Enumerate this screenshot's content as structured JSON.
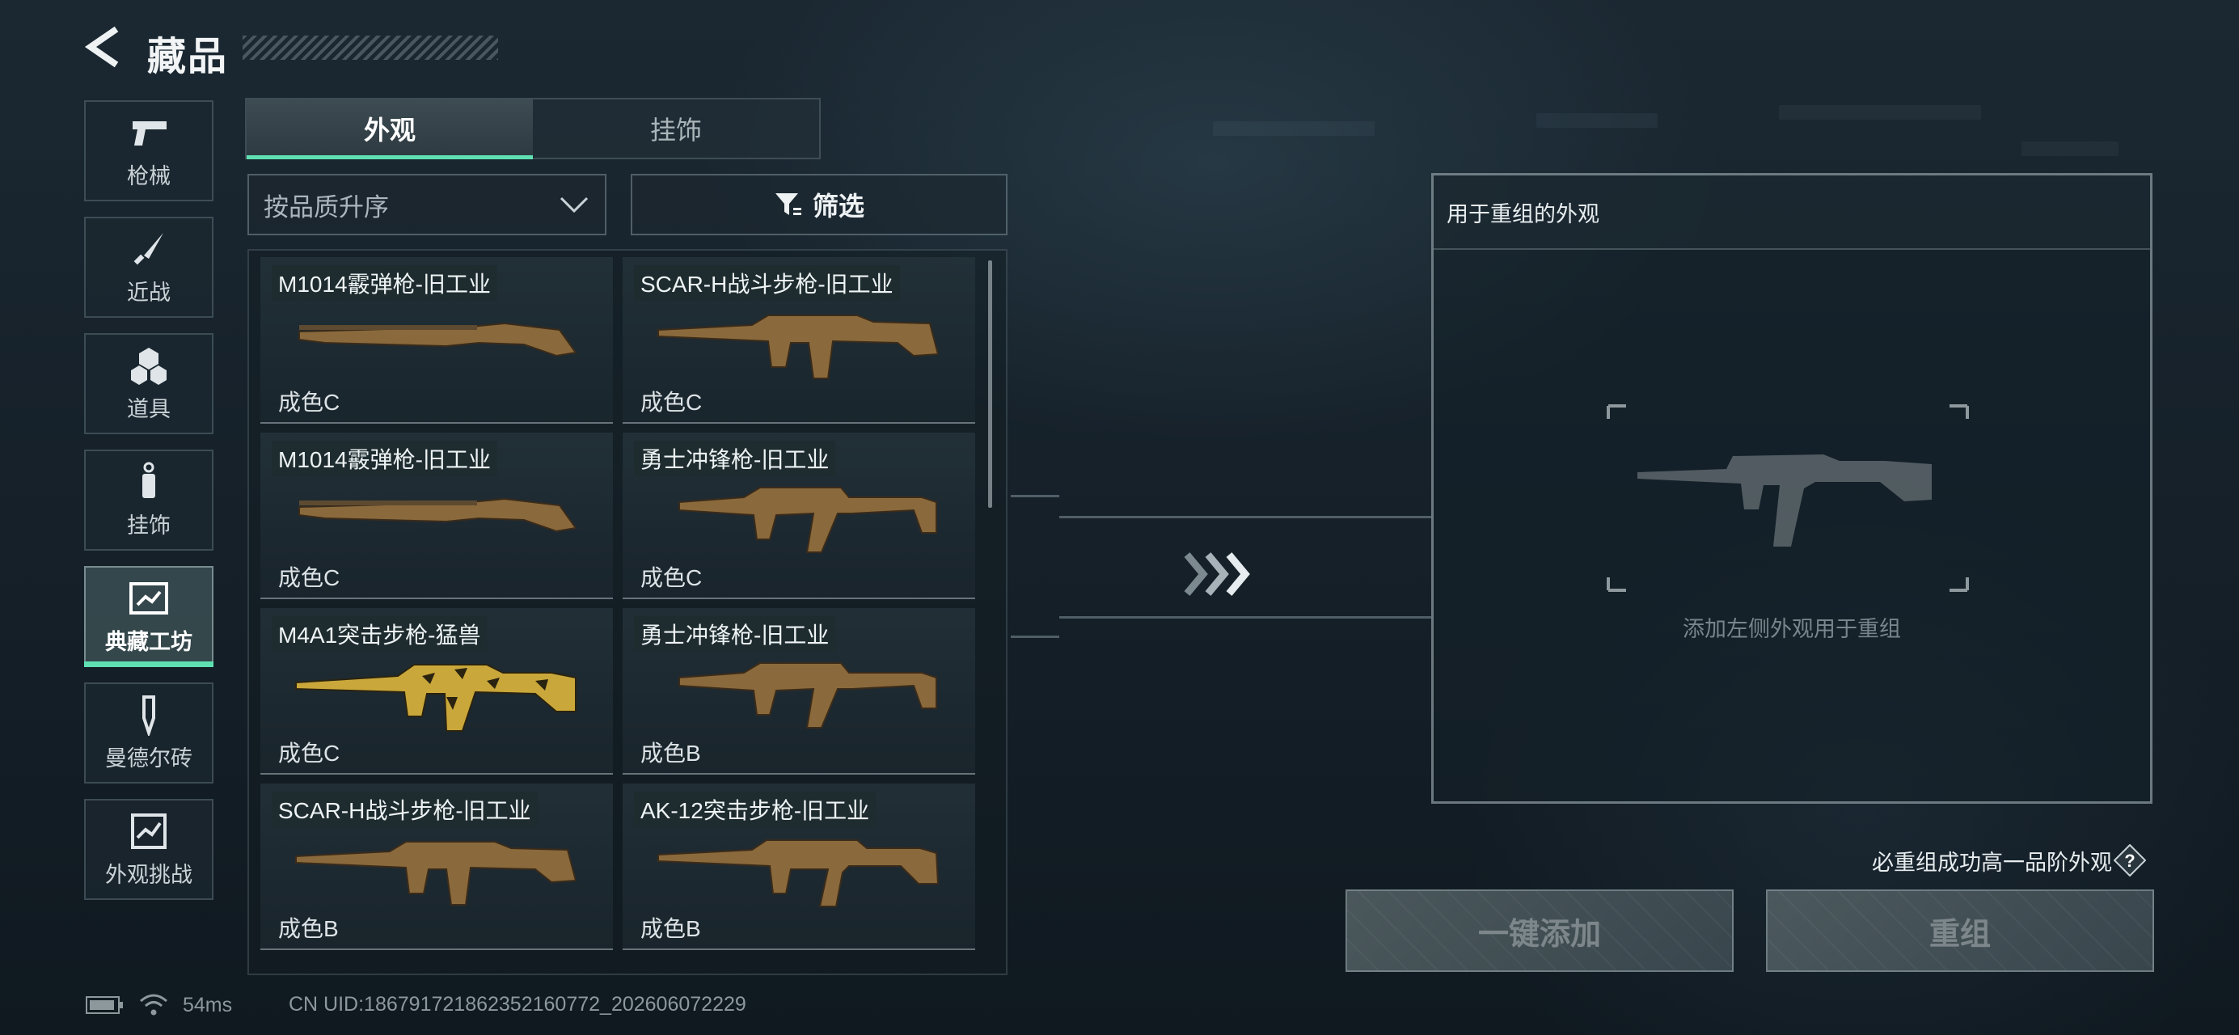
{
  "header": {
    "title": "藏品"
  },
  "nav": [
    {
      "label": "枪械",
      "icon": "pistol-icon"
    },
    {
      "label": "近战",
      "icon": "knife-icon"
    },
    {
      "label": "道具",
      "icon": "grenades-icon"
    },
    {
      "label": "挂饰",
      "icon": "charm-tag-icon"
    },
    {
      "label": "典藏工坊",
      "icon": "workshop-image-icon",
      "active": true
    },
    {
      "label": "曼德尔砖",
      "icon": "mandel-brick-icon"
    },
    {
      "label": "外观挑战",
      "icon": "challenge-map-icon"
    }
  ],
  "tabs": [
    {
      "label": "外观",
      "active": true
    },
    {
      "label": "挂饰",
      "active": false
    }
  ],
  "sort": {
    "label": "按品质升序"
  },
  "filter": {
    "label": "筛选"
  },
  "items": [
    {
      "name": "M1014霰弹枪-旧工业",
      "grade": "成色C",
      "weapon": "shotgun-icon"
    },
    {
      "name": "SCAR-H战斗步枪-旧工业",
      "grade": "成色C",
      "weapon": "rifle-icon"
    },
    {
      "name": "M1014霰弹枪-旧工业",
      "grade": "成色C",
      "weapon": "shotgun-icon"
    },
    {
      "name": "勇士冲锋枪-旧工业",
      "grade": "成色C",
      "weapon": "smg-icon"
    },
    {
      "name": "M4A1突击步枪-猛兽",
      "grade": "成色C",
      "weapon": "rifle-icon"
    },
    {
      "name": "勇士冲锋枪-旧工业",
      "grade": "成色B",
      "weapon": "smg-icon"
    },
    {
      "name": "SCAR-H战斗步枪-旧工业",
      "grade": "成色B",
      "weapon": "rifle-icon"
    },
    {
      "name": "AK-12突击步枪-旧工业",
      "grade": "成色B",
      "weapon": "rifle-icon"
    }
  ],
  "panel": {
    "title": "用于重组的外观",
    "placeholder": "添加左侧外观用于重组"
  },
  "hint": "必重组成功高一品阶外观",
  "help_label": "?",
  "buttons": {
    "add_all": "一键添加",
    "recombine": "重组"
  },
  "status": {
    "ping": "54ms",
    "uid": "CN UID:186791721862352160772_202606072229"
  },
  "colors": {
    "accent": "#5fe0b2",
    "weathered_skin": "#8a6a3c",
    "beast_skin": "#c9a73a"
  }
}
